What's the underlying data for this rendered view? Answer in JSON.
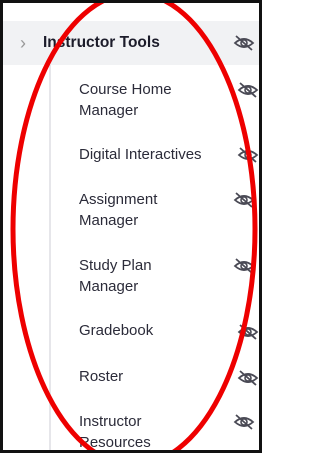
{
  "panel": {
    "header": {
      "title": "Instructor Tools",
      "chevron_icon": "chevron-right-icon",
      "visibility_icon": "eye-off-icon"
    },
    "items": [
      {
        "label": "Course Home Manager",
        "visibility_icon": "eye-off-icon"
      },
      {
        "label": "Digital Interactives",
        "visibility_icon": "eye-off-icon"
      },
      {
        "label": "Assignment Manager",
        "visibility_icon": "eye-off-icon"
      },
      {
        "label": "Study Plan Manager",
        "visibility_icon": "eye-off-icon"
      },
      {
        "label": "Gradebook",
        "visibility_icon": "eye-off-icon"
      },
      {
        "label": "Roster",
        "visibility_icon": "eye-off-icon"
      },
      {
        "label": "Instructor Resources",
        "visibility_icon": "eye-off-icon"
      }
    ]
  },
  "colors": {
    "header_background": "#f1f2f4",
    "text": "#2b2b39",
    "header_text": "#1c1c2a",
    "icon": "#4a4a55",
    "annotation": "#ee0000",
    "frame_border": "#111111"
  }
}
